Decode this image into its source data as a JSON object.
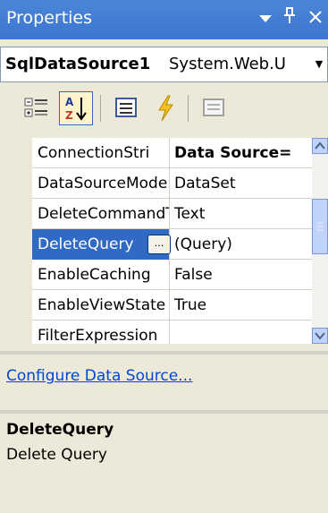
{
  "window": {
    "title": "Properties"
  },
  "object_selector": {
    "name": "SqlDataSource1",
    "type": "System.Web.U"
  },
  "grid": {
    "rows": [
      {
        "name": "ConnectionStri",
        "value": "Data Source="
      },
      {
        "name": "DataSourceMode",
        "value": "DataSet"
      },
      {
        "name": "DeleteCommandType",
        "value": "Text"
      },
      {
        "name": "DeleteQuery",
        "value": "(Query)",
        "ellipsis": "..."
      },
      {
        "name": "EnableCaching",
        "value": "False"
      },
      {
        "name": "EnableViewState",
        "value": "True"
      },
      {
        "name": "FilterExpression",
        "value": ""
      }
    ]
  },
  "commands": {
    "configure_label": "Configure Data Source..."
  },
  "description": {
    "title": "DeleteQuery",
    "text": "Delete Query"
  },
  "icons": {
    "pin": "pin-icon",
    "close": "close-icon",
    "dropdown": "chevron-down-icon",
    "categorized": "categorized-icon",
    "alphabetical": "alphabetical-sort-icon",
    "properties": "properties-icon",
    "events": "lightning-events-icon",
    "property_pages": "property-pages-icon"
  },
  "colors": {
    "title_bar": "#3d75cf",
    "selection": "#316ac5",
    "link": "#0046d5"
  }
}
